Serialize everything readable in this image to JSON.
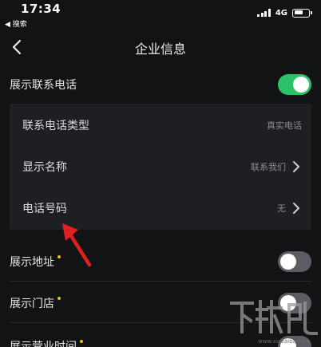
{
  "status_bar": {
    "time": "17:34",
    "back_app": "◀ 搜索",
    "network": "4G"
  },
  "nav": {
    "title": "企业信息"
  },
  "show_phone": {
    "label": "展示联系电话",
    "enabled": true
  },
  "phone_panel": {
    "items": [
      {
        "label": "联系电话类型",
        "value": "真实电话",
        "has_chevron": false
      },
      {
        "label": "显示名称",
        "value": "联系我们",
        "has_chevron": true
      },
      {
        "label": "电话号码",
        "value": "无",
        "has_chevron": true
      }
    ]
  },
  "settings": [
    {
      "label": "展示地址",
      "required": true,
      "enabled": false
    },
    {
      "label": "展示门店",
      "required": true,
      "enabled": false
    },
    {
      "label": "展示营业时间",
      "required": true,
      "enabled": false
    }
  ],
  "colors": {
    "background": "#121315",
    "panel": "#1e1f23",
    "toggle_on": "#2cc26a",
    "toggle_off": "#5b5d62",
    "required_dot": "#f0b90b",
    "annotation_arrow": "#e02020"
  },
  "watermark": {
    "text": "www.xiazaiba.com"
  }
}
